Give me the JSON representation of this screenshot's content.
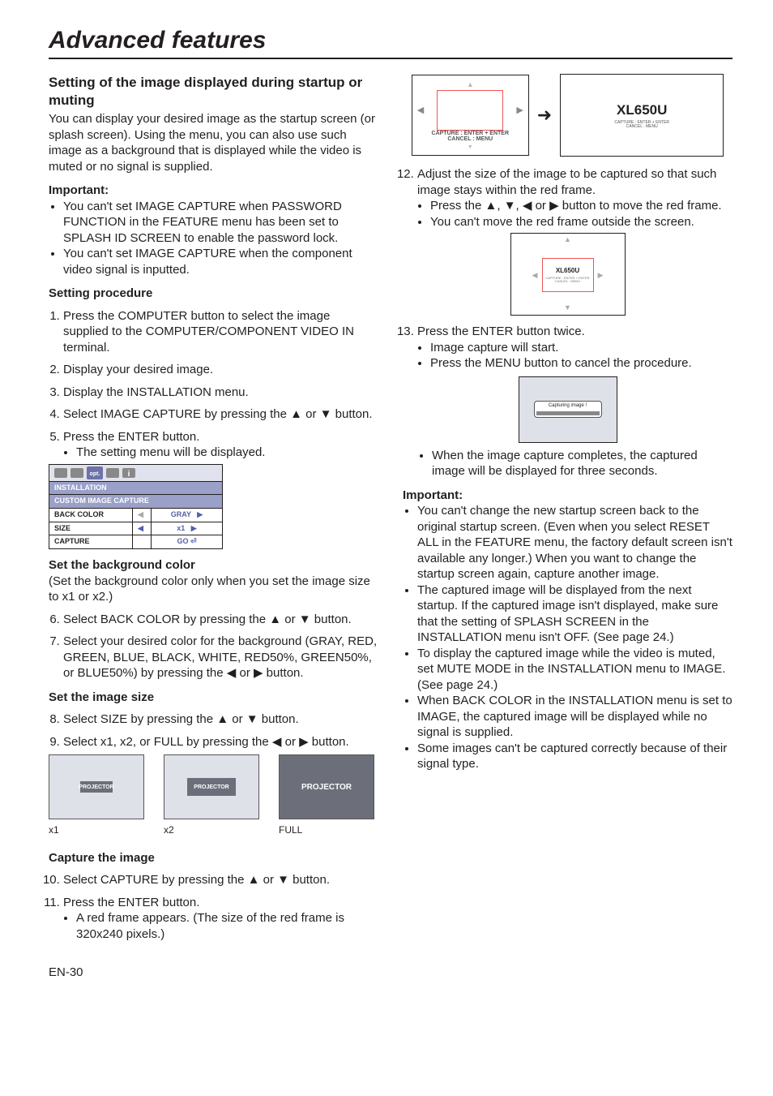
{
  "doc_title": "Advanced features",
  "page_footer": "EN-30",
  "left": {
    "heading": "Setting of the image displayed during startup or muting",
    "intro": "You can display your desired image as the startup screen (or splash screen). Using the menu, you can also use such image as a background that is displayed while the video is muted or no signal is supplied.",
    "important_label": "Important:",
    "important_bullets": [
      "You can't set IMAGE CAPTURE when PASSWORD FUNCTION in the FEATURE menu has been set to SPLASH ID SCREEN to enable the password lock.",
      "You can't set IMAGE CAPTURE when the component video signal is inputted."
    ],
    "setting_procedure_label": "Setting procedure",
    "steps_1_5": [
      "Press the COMPUTER button to select the image supplied to the COMPUTER/COMPONENT VIDEO IN terminal.",
      "Display your desired image.",
      "Display the INSTALLATION menu.",
      "Select IMAGE CAPTURE by pressing the ▲ or ▼ button.",
      "Press the ENTER button."
    ],
    "step5_sub": "The setting menu will be displayed.",
    "menu": {
      "installation": "INSTALLATION",
      "custom_image_capture": "CUSTOM IMAGE CAPTURE",
      "back_color_label": "BACK COLOR",
      "back_color_value": "GRAY",
      "size_label": "SIZE",
      "size_value": "x1",
      "capture_label": "CAPTURE",
      "capture_value": "GO"
    },
    "set_background_label": "Set the background color",
    "set_background_note": "(Set the background color only when you set the image size to x1 or x2.)",
    "steps_6_7": [
      "Select BACK COLOR by pressing the ▲ or ▼ button.",
      "Select your desired color for the background (GRAY, RED, GREEN, BLUE, BLACK, WHITE, RED50%, GREEN50%, or BLUE50%) by pressing the ◀ or ▶ button."
    ],
    "set_image_size_label": "Set the image size",
    "steps_8_9": [
      "Select SIZE by pressing the ▲ or ▼ button.",
      "Select x1, x2, or FULL by pressing the ◀ or ▶ button."
    ],
    "previews": {
      "x1": "x1",
      "x2": "x2",
      "full": "FULL",
      "logo": "PROJECTOR"
    },
    "capture_image_label": "Capture the image",
    "steps_10_11": [
      "Select CAPTURE by pressing the ▲ or ▼ button.",
      "Press the ENTER button."
    ],
    "step11_sub": "A red frame appears. (The size of the red frame is 320x240 pixels.)"
  },
  "right": {
    "crop_hint1": "CAPTURE : ENTER + ENTER",
    "crop_hint2": "CANCEL : MENU",
    "target_logo": "XL650U",
    "step12": "Adjust the size of the image to be captured so that such image stays within the red frame.",
    "step12_bullets": [
      "Press the ▲, ▼, ◀ or ▶ button to move the red frame.",
      "You can't move the red frame outside the screen."
    ],
    "step13": "Press the ENTER button twice.",
    "step13_bullets": [
      "Image capture will start.",
      "Press the MENU button to cancel the procedure."
    ],
    "status_text": "Capturing image !",
    "post_capture_bullet": "When the image capture completes, the captured image will be displayed for three seconds.",
    "important_label": "Important:",
    "important_bullets": [
      "You can't change the new startup screen back to the original startup screen. (Even when you select RESET ALL in the FEATURE menu, the factory default screen isn't available any longer.) When you want to change the startup screen again, capture another image.",
      "The captured image will be displayed from the next startup. If the captured image isn't displayed, make sure that the setting of SPLASH SCREEN in the INSTALLATION menu isn't OFF. (See page 24.)",
      "To display the captured image while the video is muted, set MUTE MODE in the INSTALLATION menu to IMAGE. (See page 24.)",
      "When BACK COLOR in the INSTALLATION menu is set to IMAGE, the captured image will be displayed while no signal is supplied.",
      "Some images can't be captured correctly because of their signal type."
    ]
  }
}
